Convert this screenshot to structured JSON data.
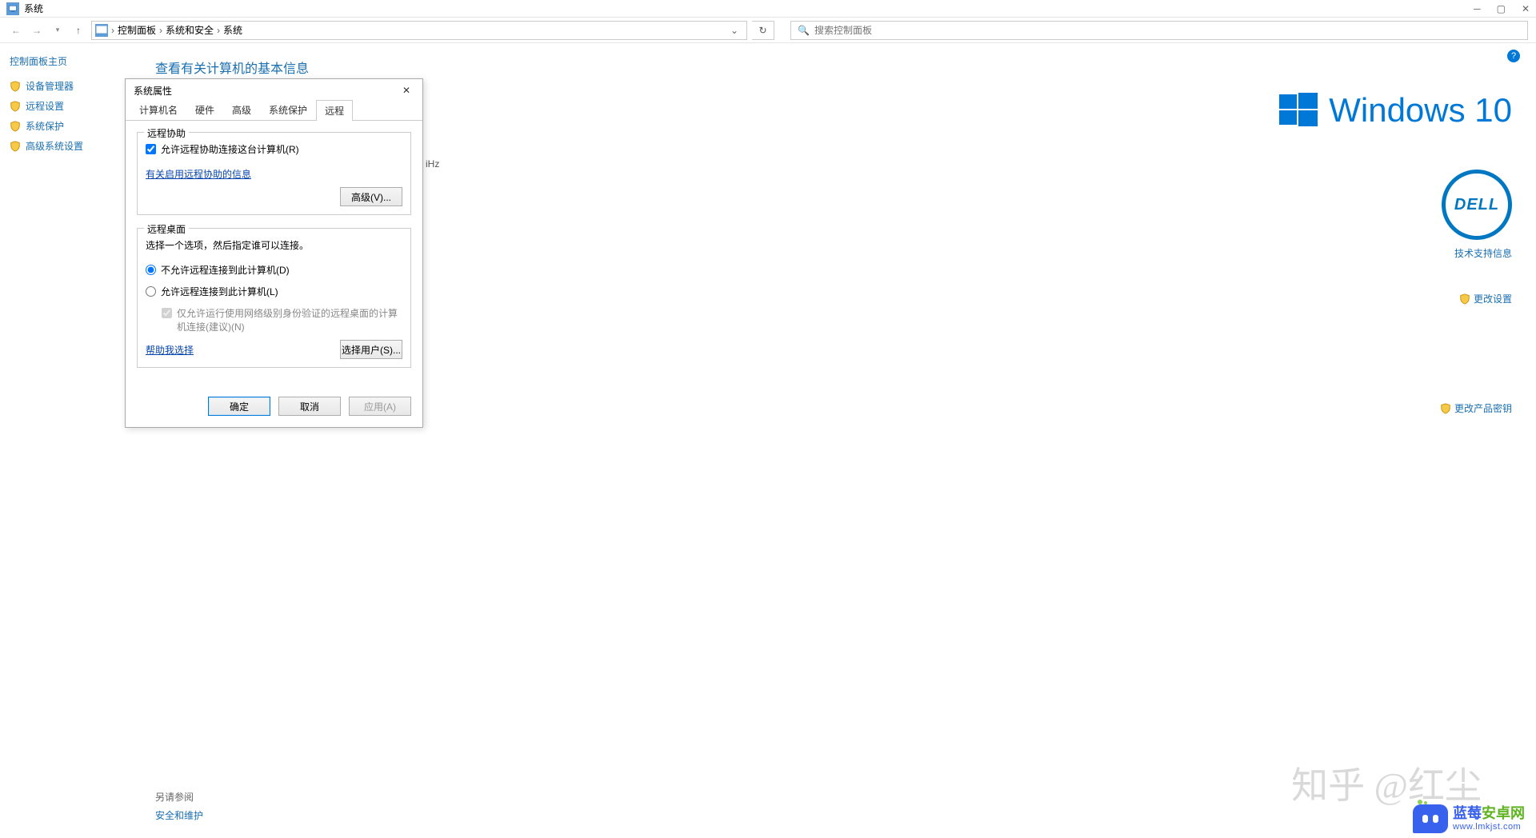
{
  "titlebar": {
    "title": "系统"
  },
  "breadcrumb": {
    "items": [
      "控制面板",
      "系统和安全",
      "系统"
    ]
  },
  "search": {
    "placeholder": "搜索控制面板"
  },
  "sidebar": {
    "home": "控制面板主页",
    "items": [
      {
        "label": "设备管理器"
      },
      {
        "label": "远程设置"
      },
      {
        "label": "系统保护"
      },
      {
        "label": "高级系统设置"
      }
    ]
  },
  "main": {
    "heading": "查看有关计算机的基本信息",
    "partial_hz": "iHz"
  },
  "right": {
    "brand": "Windows 10",
    "dell": "DELL",
    "support": "技术支持信息",
    "change_settings": "更改设置",
    "change_key": "更改产品密钥"
  },
  "footer": {
    "see_also": "另请参阅",
    "security": "安全和维护"
  },
  "dialog": {
    "title": "系统属性",
    "tabs": [
      "计算机名",
      "硬件",
      "高级",
      "系统保护",
      "远程"
    ],
    "active_tab": 4,
    "ra": {
      "legend": "远程协助",
      "allow": "允许远程协助连接这台计算机(R)",
      "info_link": "有关启用远程协助的信息",
      "advanced_btn": "高级(V)..."
    },
    "rd": {
      "legend": "远程桌面",
      "desc": "选择一个选项，然后指定谁可以连接。",
      "opt_deny": "不允许远程连接到此计算机(D)",
      "opt_allow": "允许远程连接到此计算机(L)",
      "nla": "仅允许运行使用网络级别身份验证的远程桌面的计算机连接(建议)(N)",
      "help_link": "帮助我选择",
      "select_users_btn": "选择用户(S)..."
    },
    "buttons": {
      "ok": "确定",
      "cancel": "取消",
      "apply": "应用(A)"
    }
  },
  "watermark": {
    "zhihu": "知乎 @红尘",
    "lanmei_cn": "蓝莓安卓网",
    "lanmei_url": "www.lmkjst.com"
  }
}
